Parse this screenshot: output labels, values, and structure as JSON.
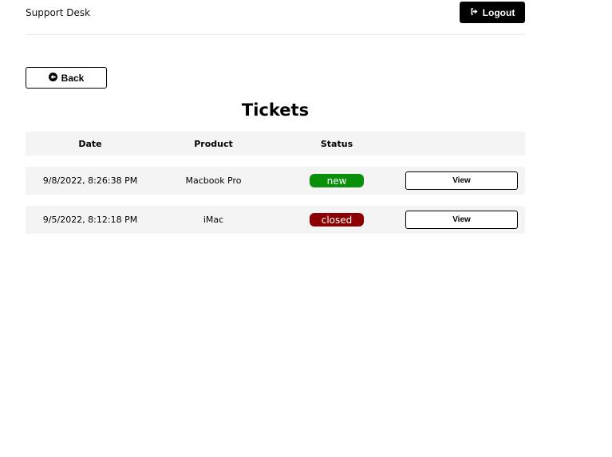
{
  "header": {
    "brand": "Support Desk",
    "logout_label": "Logout"
  },
  "back_label": "Back",
  "page_title": "Tickets",
  "table": {
    "columns": [
      "Date",
      "Product",
      "Status",
      ""
    ],
    "rows": [
      {
        "date": "9/8/2022, 8:26:38 PM",
        "product": "Macbook Pro",
        "status": "new",
        "status_color": "#0a8f0a",
        "action": "View"
      },
      {
        "date": "9/5/2022, 8:12:18 PM",
        "product": "iMac",
        "status": "closed",
        "status_color": "#8b0000",
        "action": "View"
      }
    ]
  },
  "icons": {
    "logout": "sign-out-icon",
    "back": "arrow-circle-left-icon"
  }
}
